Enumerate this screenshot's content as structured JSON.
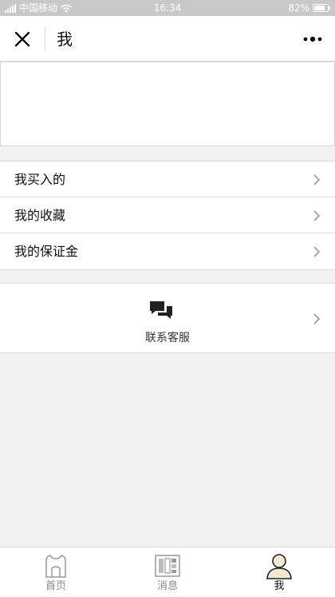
{
  "status_bar": {
    "carrier": "中国移动",
    "time": "16:34",
    "battery_percent": "82%",
    "battery_level": 0.82
  },
  "nav": {
    "title": "我",
    "close_icon": "close-icon",
    "more_icon": "more-icon"
  },
  "menu": {
    "items": [
      {
        "label": "我买入的"
      },
      {
        "label": "我的收藏"
      },
      {
        "label": "我的保证金"
      }
    ]
  },
  "service": {
    "label": "联系客服",
    "icon": "chat-icon"
  },
  "tabbar": {
    "items": [
      {
        "label": "首页",
        "icon": "home-icon",
        "active": false
      },
      {
        "label": "消息",
        "icon": "message-icon",
        "active": false
      },
      {
        "label": "我",
        "icon": "profile-icon",
        "active": true
      }
    ]
  },
  "colors": {
    "status_bg": "#c9c9c9",
    "page_bg": "#f2f2f2",
    "card_bg": "#ffffff",
    "divider": "#dcdcdc",
    "text_primary": "#111111",
    "text_secondary": "#888888",
    "accent_beige": "#f5e8d0"
  }
}
